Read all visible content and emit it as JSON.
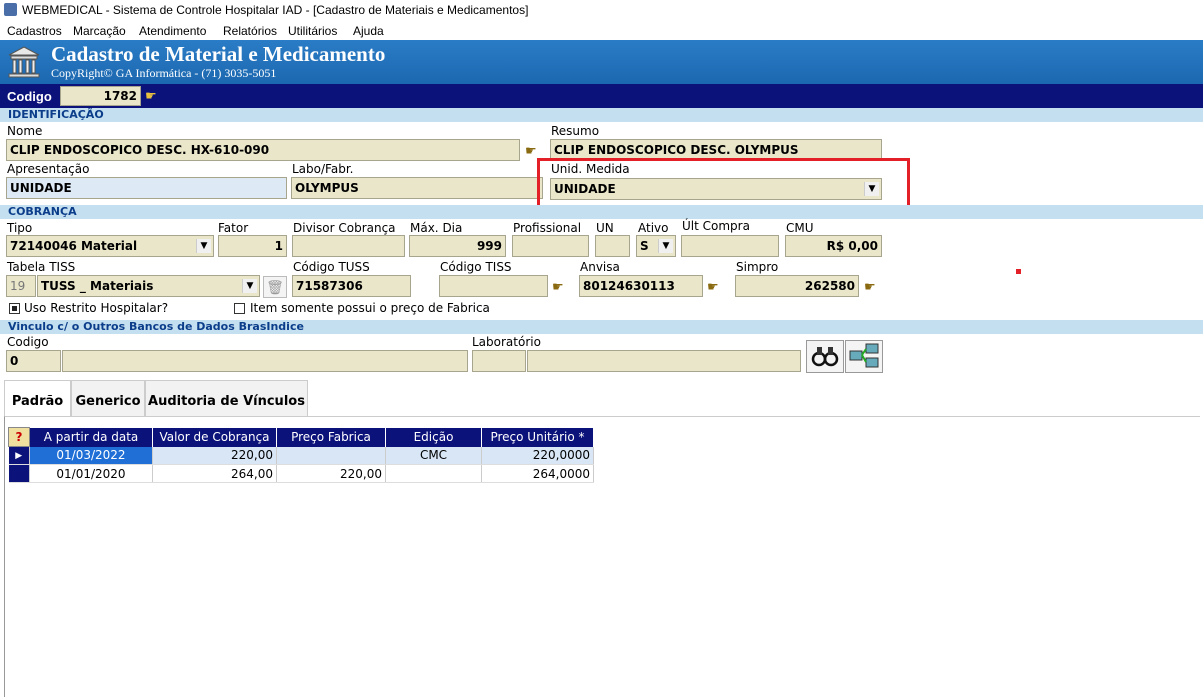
{
  "window": {
    "title": "WEBMEDICAL - Sistema de Controle Hospitalar IAD - [Cadastro de Materiais e Medicamentos]"
  },
  "menu": [
    "Cadastros",
    "Marcação",
    "Atendimento",
    "Relatórios",
    "Utilitários",
    "Ajuda"
  ],
  "banner": {
    "title": "Cadastro de Material e Medicamento",
    "copyright": "CopyRight© GA Informática - (71) 3035-5051"
  },
  "codigo": {
    "label": "Codigo",
    "value": "1782"
  },
  "identificacao": {
    "section": "IDENTIFICAÇÃO",
    "nome_label": "Nome",
    "nome": "CLIP ENDOSCOPICO DESC. HX-610-090",
    "resumo_label": "Resumo",
    "resumo": "CLIP ENDOSCOPICO DESC. OLYMPUS",
    "apresentacao_label": "Apresentação",
    "apresentacao": "UNIDADE",
    "labo_label": "Labo/Fabr.",
    "labo": "OLYMPUS",
    "unid_label": "Unid. Medida",
    "unid": "UNIDADE"
  },
  "cobranca": {
    "section": "COBRANÇA",
    "tipo_label": "Tipo",
    "tipo": "72140046 Material",
    "fator_label": "Fator",
    "fator": "1",
    "divisor_label": "Divisor Cobrança",
    "divisor": "",
    "maxdia_label": "Máx. Dia",
    "maxdia": "999",
    "profissional_label": "Profissional",
    "profissional": "",
    "un_label": "UN",
    "un": "",
    "ativo_label": "Ativo",
    "ativo": "S",
    "ultcompra_label": "Últ Compra",
    "ultcompra": "",
    "cmu_label": "CMU",
    "cmu": "R$ 0,00",
    "tabela_label": "Tabela TISS",
    "tabela_num": "19",
    "tabela": "TUSS _ Materiais",
    "codtuss_label": "Código TUSS",
    "codtuss": "71587306",
    "codtiss_label": "Código TISS",
    "codtiss": "",
    "anvisa_label": "Anvisa",
    "anvisa": "80124630113",
    "simpro_label": "Simpro",
    "simpro": "262580",
    "uso_restrito": "Uso Restrito Hospitalar?",
    "item_fabrica": "Item somente possui o preço de Fabrica"
  },
  "vinculo": {
    "section": "Vinculo c/ o Outros Bancos de Dados BrasIndice",
    "codigo_label": "Codigo",
    "codigo": "0",
    "lab_label": "Laboratório"
  },
  "tabs": [
    "Padrão",
    "Generico",
    "Auditoria de Vínculos"
  ],
  "grid": {
    "q": "?",
    "headers": [
      "A partir da data",
      "Valor de Cobrança",
      "Preço Fabrica",
      "Edição",
      "Preço Unitário *"
    ],
    "rows": [
      [
        "01/03/2022",
        "220,00",
        "",
        "CMC",
        "220,0000"
      ],
      [
        "01/01/2020",
        "264,00",
        "220,00",
        "",
        "264,0000"
      ]
    ]
  }
}
